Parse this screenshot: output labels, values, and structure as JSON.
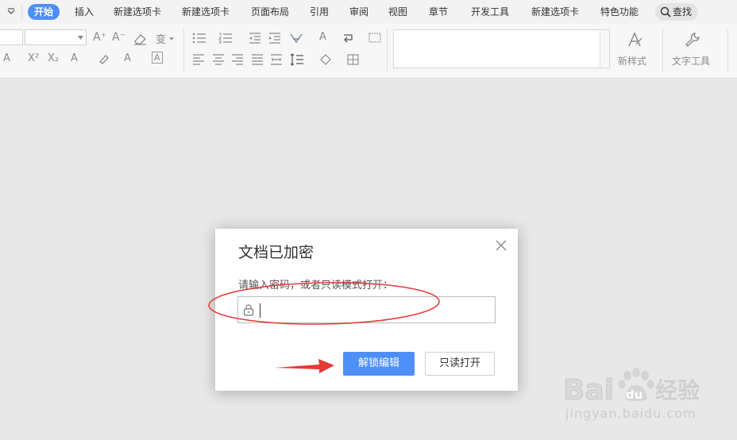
{
  "tabs": [
    {
      "label": "开始",
      "active": true
    },
    {
      "label": "插入"
    },
    {
      "label": "新建选项卡"
    },
    {
      "label": "新建选项卡"
    },
    {
      "label": "页面布局"
    },
    {
      "label": "引用"
    },
    {
      "label": "审阅"
    },
    {
      "label": "视图"
    },
    {
      "label": "章节"
    },
    {
      "label": "开发工具"
    },
    {
      "label": "新建选项卡"
    },
    {
      "label": "特色功能"
    }
  ],
  "search": {
    "label": "查找"
  },
  "toolbar": {
    "x2": "X²",
    "x_sub": "X₂",
    "new_style": "新样式",
    "text_tool": "文字工具"
  },
  "dialog": {
    "title": "文档已加密",
    "prompt": "请输入密码，或者只读模式打开：",
    "password_value": "",
    "unlock_button": "解锁编辑",
    "readonly_button": "只读打开"
  },
  "watermark": {
    "brand": "Bai",
    "brand2": "du",
    "brand_cn": "经验",
    "url": "jingyan.baidu.com"
  },
  "colors": {
    "accent": "#4e8ef7",
    "annotation": "#e53935"
  }
}
